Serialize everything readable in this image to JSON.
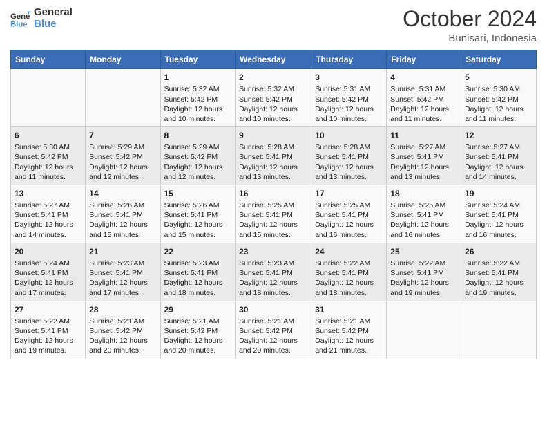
{
  "logo": {
    "line1": "General",
    "line2": "Blue"
  },
  "title": "October 2024",
  "subtitle": "Bunisari, Indonesia",
  "weekdays": [
    "Sunday",
    "Monday",
    "Tuesday",
    "Wednesday",
    "Thursday",
    "Friday",
    "Saturday"
  ],
  "weeks": [
    [
      {
        "day": "",
        "sunrise": "",
        "sunset": "",
        "daylight": ""
      },
      {
        "day": "",
        "sunrise": "",
        "sunset": "",
        "daylight": ""
      },
      {
        "day": "1",
        "sunrise": "Sunrise: 5:32 AM",
        "sunset": "Sunset: 5:42 PM",
        "daylight": "Daylight: 12 hours and 10 minutes."
      },
      {
        "day": "2",
        "sunrise": "Sunrise: 5:32 AM",
        "sunset": "Sunset: 5:42 PM",
        "daylight": "Daylight: 12 hours and 10 minutes."
      },
      {
        "day": "3",
        "sunrise": "Sunrise: 5:31 AM",
        "sunset": "Sunset: 5:42 PM",
        "daylight": "Daylight: 12 hours and 10 minutes."
      },
      {
        "day": "4",
        "sunrise": "Sunrise: 5:31 AM",
        "sunset": "Sunset: 5:42 PM",
        "daylight": "Daylight: 12 hours and 11 minutes."
      },
      {
        "day": "5",
        "sunrise": "Sunrise: 5:30 AM",
        "sunset": "Sunset: 5:42 PM",
        "daylight": "Daylight: 12 hours and 11 minutes."
      }
    ],
    [
      {
        "day": "6",
        "sunrise": "Sunrise: 5:30 AM",
        "sunset": "Sunset: 5:42 PM",
        "daylight": "Daylight: 12 hours and 11 minutes."
      },
      {
        "day": "7",
        "sunrise": "Sunrise: 5:29 AM",
        "sunset": "Sunset: 5:42 PM",
        "daylight": "Daylight: 12 hours and 12 minutes."
      },
      {
        "day": "8",
        "sunrise": "Sunrise: 5:29 AM",
        "sunset": "Sunset: 5:42 PM",
        "daylight": "Daylight: 12 hours and 12 minutes."
      },
      {
        "day": "9",
        "sunrise": "Sunrise: 5:28 AM",
        "sunset": "Sunset: 5:41 PM",
        "daylight": "Daylight: 12 hours and 13 minutes."
      },
      {
        "day": "10",
        "sunrise": "Sunrise: 5:28 AM",
        "sunset": "Sunset: 5:41 PM",
        "daylight": "Daylight: 12 hours and 13 minutes."
      },
      {
        "day": "11",
        "sunrise": "Sunrise: 5:27 AM",
        "sunset": "Sunset: 5:41 PM",
        "daylight": "Daylight: 12 hours and 13 minutes."
      },
      {
        "day": "12",
        "sunrise": "Sunrise: 5:27 AM",
        "sunset": "Sunset: 5:41 PM",
        "daylight": "Daylight: 12 hours and 14 minutes."
      }
    ],
    [
      {
        "day": "13",
        "sunrise": "Sunrise: 5:27 AM",
        "sunset": "Sunset: 5:41 PM",
        "daylight": "Daylight: 12 hours and 14 minutes."
      },
      {
        "day": "14",
        "sunrise": "Sunrise: 5:26 AM",
        "sunset": "Sunset: 5:41 PM",
        "daylight": "Daylight: 12 hours and 15 minutes."
      },
      {
        "day": "15",
        "sunrise": "Sunrise: 5:26 AM",
        "sunset": "Sunset: 5:41 PM",
        "daylight": "Daylight: 12 hours and 15 minutes."
      },
      {
        "day": "16",
        "sunrise": "Sunrise: 5:25 AM",
        "sunset": "Sunset: 5:41 PM",
        "daylight": "Daylight: 12 hours and 15 minutes."
      },
      {
        "day": "17",
        "sunrise": "Sunrise: 5:25 AM",
        "sunset": "Sunset: 5:41 PM",
        "daylight": "Daylight: 12 hours and 16 minutes."
      },
      {
        "day": "18",
        "sunrise": "Sunrise: 5:25 AM",
        "sunset": "Sunset: 5:41 PM",
        "daylight": "Daylight: 12 hours and 16 minutes."
      },
      {
        "day": "19",
        "sunrise": "Sunrise: 5:24 AM",
        "sunset": "Sunset: 5:41 PM",
        "daylight": "Daylight: 12 hours and 16 minutes."
      }
    ],
    [
      {
        "day": "20",
        "sunrise": "Sunrise: 5:24 AM",
        "sunset": "Sunset: 5:41 PM",
        "daylight": "Daylight: 12 hours and 17 minutes."
      },
      {
        "day": "21",
        "sunrise": "Sunrise: 5:23 AM",
        "sunset": "Sunset: 5:41 PM",
        "daylight": "Daylight: 12 hours and 17 minutes."
      },
      {
        "day": "22",
        "sunrise": "Sunrise: 5:23 AM",
        "sunset": "Sunset: 5:41 PM",
        "daylight": "Daylight: 12 hours and 18 minutes."
      },
      {
        "day": "23",
        "sunrise": "Sunrise: 5:23 AM",
        "sunset": "Sunset: 5:41 PM",
        "daylight": "Daylight: 12 hours and 18 minutes."
      },
      {
        "day": "24",
        "sunrise": "Sunrise: 5:22 AM",
        "sunset": "Sunset: 5:41 PM",
        "daylight": "Daylight: 12 hours and 18 minutes."
      },
      {
        "day": "25",
        "sunrise": "Sunrise: 5:22 AM",
        "sunset": "Sunset: 5:41 PM",
        "daylight": "Daylight: 12 hours and 19 minutes."
      },
      {
        "day": "26",
        "sunrise": "Sunrise: 5:22 AM",
        "sunset": "Sunset: 5:41 PM",
        "daylight": "Daylight: 12 hours and 19 minutes."
      }
    ],
    [
      {
        "day": "27",
        "sunrise": "Sunrise: 5:22 AM",
        "sunset": "Sunset: 5:41 PM",
        "daylight": "Daylight: 12 hours and 19 minutes."
      },
      {
        "day": "28",
        "sunrise": "Sunrise: 5:21 AM",
        "sunset": "Sunset: 5:42 PM",
        "daylight": "Daylight: 12 hours and 20 minutes."
      },
      {
        "day": "29",
        "sunrise": "Sunrise: 5:21 AM",
        "sunset": "Sunset: 5:42 PM",
        "daylight": "Daylight: 12 hours and 20 minutes."
      },
      {
        "day": "30",
        "sunrise": "Sunrise: 5:21 AM",
        "sunset": "Sunset: 5:42 PM",
        "daylight": "Daylight: 12 hours and 20 minutes."
      },
      {
        "day": "31",
        "sunrise": "Sunrise: 5:21 AM",
        "sunset": "Sunset: 5:42 PM",
        "daylight": "Daylight: 12 hours and 21 minutes."
      },
      {
        "day": "",
        "sunrise": "",
        "sunset": "",
        "daylight": ""
      },
      {
        "day": "",
        "sunrise": "",
        "sunset": "",
        "daylight": ""
      }
    ]
  ]
}
